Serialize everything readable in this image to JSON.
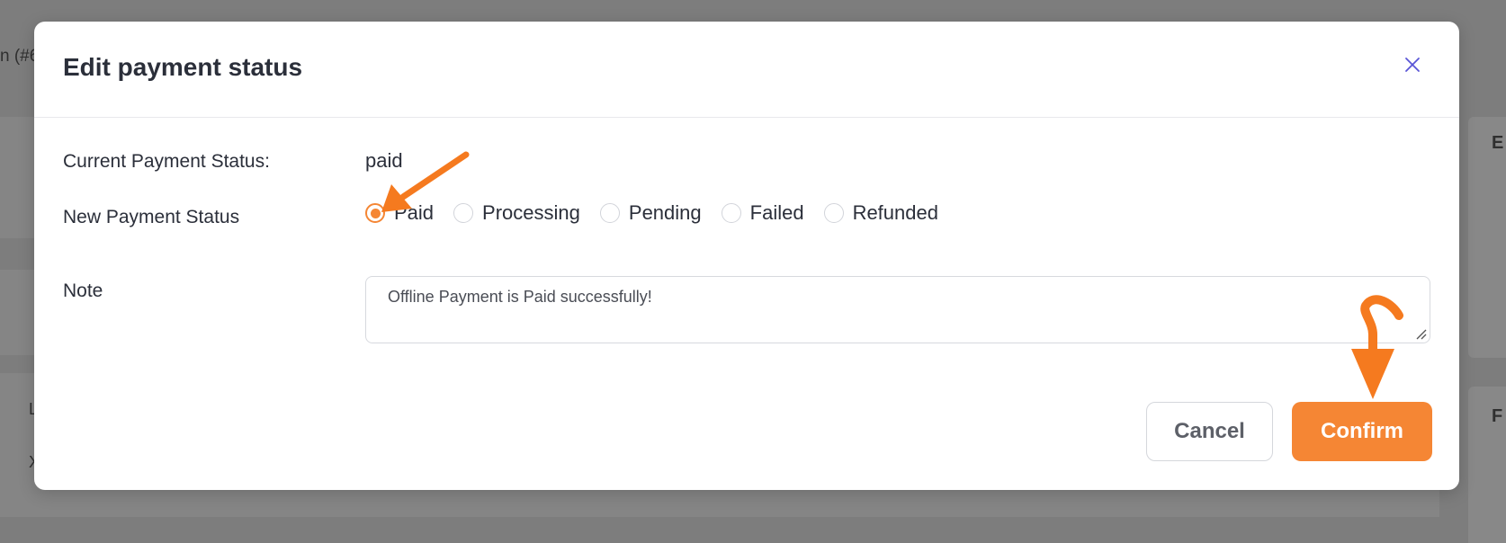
{
  "background": {
    "top_text": "n (#6",
    "right_letter_1": "E",
    "right_letter_2": "F",
    "left_letter_1": "L",
    "left_letter_2": "X"
  },
  "modal": {
    "title": "Edit payment status",
    "close_icon": "close-icon",
    "current_status_label": "Current Payment Status:",
    "current_status_value": "paid",
    "new_status_label": "New Payment Status",
    "status_options": [
      {
        "label": "Paid",
        "checked": true
      },
      {
        "label": "Processing",
        "checked": false
      },
      {
        "label": "Pending",
        "checked": false
      },
      {
        "label": "Failed",
        "checked": false
      },
      {
        "label": "Refunded",
        "checked": false
      }
    ],
    "note_label": "Note",
    "note_value": "Offline Payment is Paid successfully!",
    "cancel_label": "Cancel",
    "confirm_label": "Confirm"
  },
  "colors": {
    "accent": "#f58634",
    "close_icon": "#5a56d6",
    "overlay": "#7d7d7d"
  }
}
